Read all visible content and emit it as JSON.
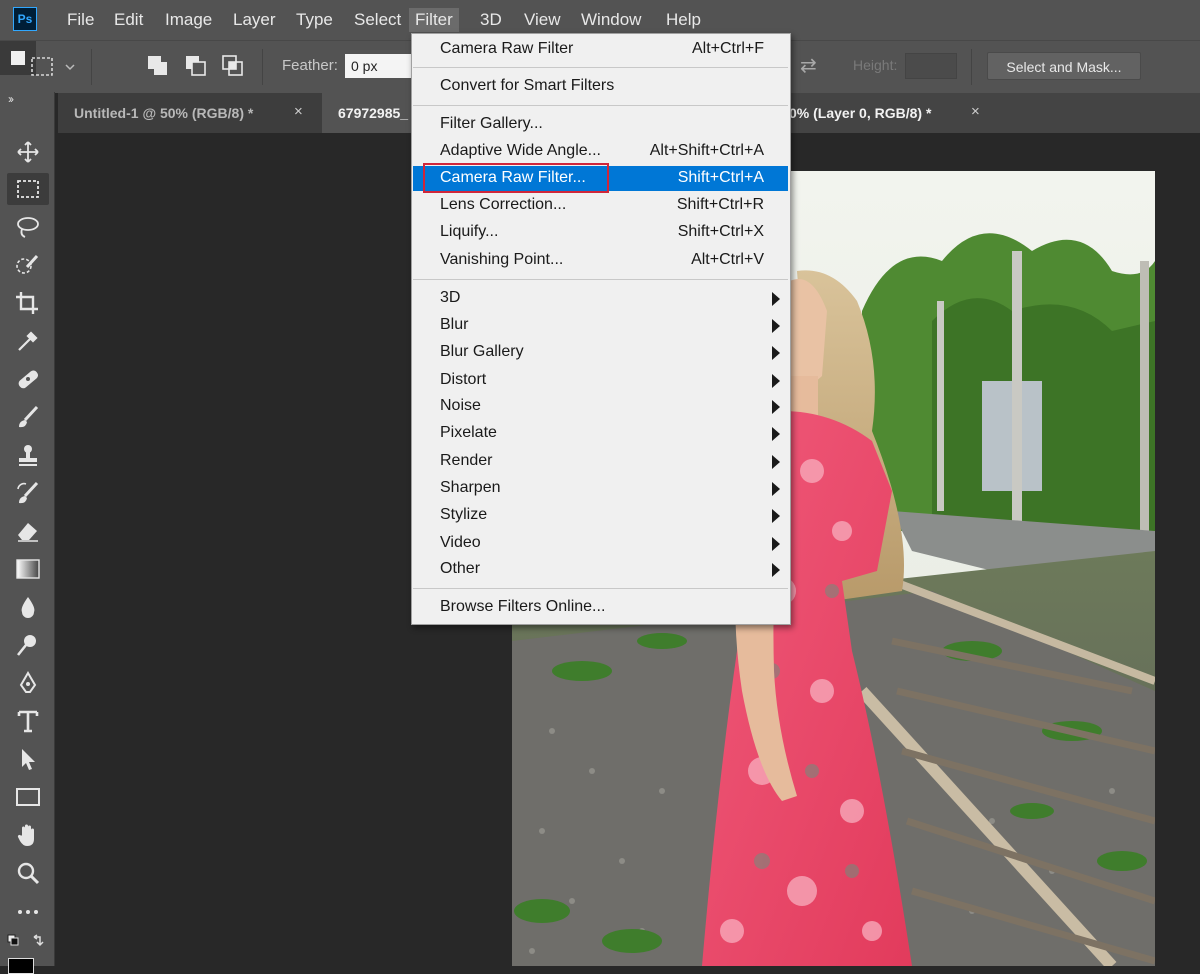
{
  "app": {
    "logo_text": "Ps"
  },
  "menubar": {
    "items": [
      "File",
      "Edit",
      "Image",
      "Layer",
      "Type",
      "Select",
      "Filter",
      "3D",
      "View",
      "Window",
      "Help"
    ]
  },
  "options": {
    "feather_label": "Feather:",
    "feather_value": "0 px",
    "height_label": "Height:",
    "select_mask_label": "Select and Mask..."
  },
  "tabs": [
    {
      "title": "Untitled-1 @ 50% (RGB/8) *",
      "close": "×"
    },
    {
      "title": "67972985_",
      "close": ""
    },
    {
      "title": "0% (Layer 0, RGB/8) *",
      "close": "×"
    }
  ],
  "toolpanel": {
    "collapse": "››"
  },
  "filter_menu": {
    "items": [
      {
        "label": "Camera Raw Filter",
        "shortcut": "Alt+Ctrl+F"
      },
      {
        "label": "Convert for Smart Filters",
        "shortcut": ""
      },
      {
        "label": "Filter Gallery...",
        "shortcut": ""
      },
      {
        "label": "Adaptive Wide Angle...",
        "shortcut": "Alt+Shift+Ctrl+A"
      },
      {
        "label": "Camera Raw Filter...",
        "shortcut": "Shift+Ctrl+A",
        "selected": true
      },
      {
        "label": "Lens Correction...",
        "shortcut": "Shift+Ctrl+R"
      },
      {
        "label": "Liquify...",
        "shortcut": "Shift+Ctrl+X"
      },
      {
        "label": "Vanishing Point...",
        "shortcut": "Alt+Ctrl+V"
      },
      {
        "label": "3D",
        "submenu": true
      },
      {
        "label": "Blur",
        "submenu": true
      },
      {
        "label": "Blur Gallery",
        "submenu": true
      },
      {
        "label": "Distort",
        "submenu": true
      },
      {
        "label": "Noise",
        "submenu": true
      },
      {
        "label": "Pixelate",
        "submenu": true
      },
      {
        "label": "Render",
        "submenu": true
      },
      {
        "label": "Sharpen",
        "submenu": true
      },
      {
        "label": "Stylize",
        "submenu": true
      },
      {
        "label": "Video",
        "submenu": true
      },
      {
        "label": "Other",
        "submenu": true
      },
      {
        "label": "Browse Filters Online...",
        "shortcut": ""
      }
    ]
  },
  "colors": {
    "highlight": "#0077d6",
    "red_outline": "#d0263a",
    "ui_panel": "#535353",
    "canvas_bg": "#282828"
  }
}
